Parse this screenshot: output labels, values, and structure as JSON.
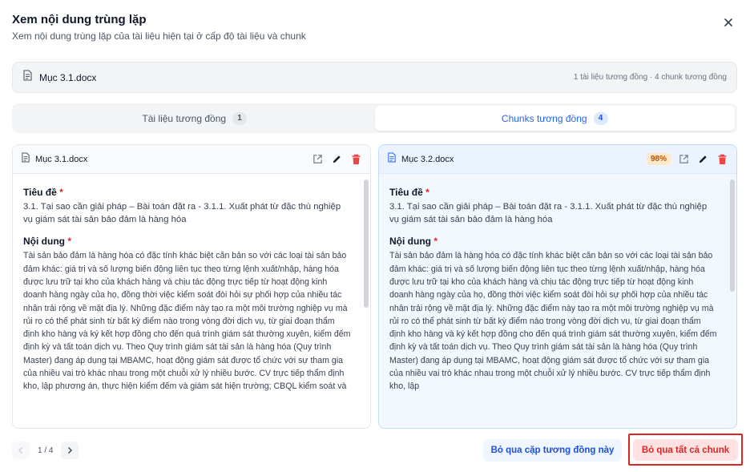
{
  "dialog": {
    "title": "Xem nội dung trùng lặp",
    "subtitle": "Xem nội dung trùng lặp của tài liệu hiện tại ở cấp độ tài liệu và chunk"
  },
  "file_bar": {
    "file_name": "Mục 3.1.docx",
    "meta": "1 tài liệu tương đồng · 4 chunk tương đồng"
  },
  "tabs": [
    {
      "label": "Tài liệu tương đồng",
      "count": "1"
    },
    {
      "label": "Chunks tương đồng",
      "count": "4",
      "active": true
    }
  ],
  "left_panel": {
    "file_name": "Mục 3.1.docx",
    "title_label": "Tiêu đề",
    "title_text": "3.1. Tại sao cần giải pháp – Bài toán đặt ra - 3.1.1. Xuất phát từ đặc thù nghiệp vụ giám sát tài sản bảo đảm là hàng hóa",
    "content_label": "Nội dung",
    "content_text": "Tài sản bảo đảm là hàng hóa có đặc tính khác biệt căn bản so với các loại tài sản bảo đảm khác: giá trị và số lượng biến động liên tục theo từng lệnh xuất/nhập, hàng hóa được lưu trữ tại kho của khách hàng và chịu tác động trực tiếp từ hoạt động kinh doanh hàng ngày của họ, đồng thời việc kiểm soát đòi hỏi sự phối hợp của nhiều tác nhân trải rộng về mặt địa lý. Những đặc điểm này tạo ra một môi trường nghiệp vụ mà rủi ro có thể phát sinh từ bất kỳ điểm nào trong vòng đời dịch vụ, từ giai đoạn thẩm định kho hàng và ký kết hợp đồng cho đến quá trình giám sát thường xuyên, kiểm đếm định kỳ và tất toán dịch vụ. Theo Quy trình giám sát tài sản là hàng hóa (Quy trình Master) đang áp dụng tại MBAMC, hoạt động giám sát được tổ chức với sự tham gia của nhiều vai trò khác nhau trong một chuỗi xử lý nhiều bước. CV trực tiếp thẩm định kho, lập phương án, thực hiện kiểm đếm và giám sát hiện trường; CBQL kiểm soát và"
  },
  "right_panel": {
    "file_name": "Mục 3.2.docx",
    "similarity": "98%",
    "title_label": "Tiêu đề",
    "title_text": "3.1. Tại sao cần giải pháp – Bài toán đặt ra - 3.1.1. Xuất phát từ đặc thù nghiệp vụ giám sát tài sản bảo đảm là hàng hóa",
    "content_label": "Nội dung",
    "content_text": "Tài sản bảo đảm là hàng hóa có đặc tính khác biệt căn bản so với các loại tài sản bảo đảm khác: giá trị và số lượng biến động liên tục theo từng lệnh xuất/nhập, hàng hóa được lưu trữ tại kho của khách hàng và chịu tác động trực tiếp từ hoạt động kinh doanh hàng ngày của họ, đồng thời việc kiểm soát đòi hỏi sự phối hợp của nhiều tác nhân trải rộng về mặt địa lý. Những đặc điểm này tạo ra một môi trường nghiệp vụ mà rủi ro có thể phát sinh từ bất kỳ điểm nào trong vòng đời dịch vụ, từ giai đoạn thẩm định kho hàng và ký kết hợp đồng cho đến quá trình giám sát thường xuyên, kiểm đếm định kỳ và tất toán dịch vụ. Theo Quy trình giám sát tài sản là hàng hóa (Quy trình Master) đang áp dụng tại MBAMC, hoạt động giám sát được tổ chức với sự tham gia của nhiều vai trò khác nhau trong một chuỗi xử lý nhiều bước. CV trực tiếp thẩm định kho, lập"
  },
  "pager": {
    "text": "1 / 4"
  },
  "buttons": {
    "skip_pair": "Bỏ qua cặp tương đồng này",
    "skip_all": "Bỏ qua tất cả chunk"
  },
  "colors": {
    "accent": "#2563eb",
    "danger": "#dc2626",
    "similarity_badge": "#fde8c8"
  }
}
